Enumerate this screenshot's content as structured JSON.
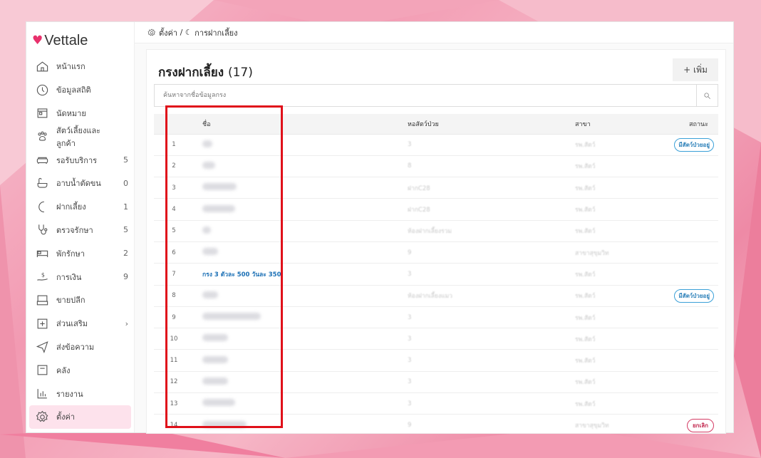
{
  "app": {
    "brand": "Vettale"
  },
  "breadcrumb": {
    "settings": "ตั้งค่า",
    "separator": "/",
    "current": "การฝากเลี้ยง"
  },
  "sidebar": {
    "items": [
      {
        "icon": "home-icon",
        "label": "หน้าแรก",
        "count": ""
      },
      {
        "icon": "chart-icon",
        "label": "ข้อมูลสถิติ",
        "count": ""
      },
      {
        "icon": "calendar-icon",
        "label": "นัดหมาย",
        "count": ""
      },
      {
        "icon": "paw-icon",
        "label": "สัตว์เลี้ยงและลูกค้า",
        "count": ""
      },
      {
        "icon": "sofa-icon",
        "label": "รอรับบริการ",
        "count": "5"
      },
      {
        "icon": "bath-icon",
        "label": "อาบน้ำตัดขน",
        "count": "0"
      },
      {
        "icon": "moon-icon",
        "label": "ฝากเลี้ยง",
        "count": "1"
      },
      {
        "icon": "stethoscope-icon",
        "label": "ตรวจรักษา",
        "count": "5"
      },
      {
        "icon": "bed-icon",
        "label": "พักรักษา",
        "count": "2"
      },
      {
        "icon": "money-icon",
        "label": "การเงิน",
        "count": "9"
      },
      {
        "icon": "register-icon",
        "label": "ขายปลีก",
        "count": ""
      },
      {
        "icon": "plus-box-icon",
        "label": "ส่วนเสริม",
        "count": "›"
      },
      {
        "icon": "send-icon",
        "label": "ส่งข้อความ",
        "count": ""
      },
      {
        "icon": "inbox-icon",
        "label": "คลัง",
        "count": ""
      },
      {
        "icon": "report-icon",
        "label": "รายงาน",
        "count": ""
      },
      {
        "icon": "gear-icon",
        "label": "ตั้งค่า",
        "count": ""
      }
    ]
  },
  "main": {
    "title": "กรงฝากเลี้ยง",
    "count": "(17)",
    "add_label": "+ เพิ่ม",
    "search_placeholder": "ค้นหาจากชื่อข้อมูลกรง",
    "columns": {
      "name": "ชื่อ",
      "vet": "หอสัตว์ป่วย",
      "branch": "สาขา",
      "status": "สถานะ"
    },
    "rows": [
      {
        "num": "1",
        "name": "",
        "vet": "3",
        "branch": "รพ.สัตว์",
        "status": "มีสัตว์ป่วยอยู่"
      },
      {
        "num": "2",
        "name": "",
        "vet": "8",
        "branch": "รพ.สัตว์",
        "status": ""
      },
      {
        "num": "3",
        "name": "",
        "vet": "ฝากC28",
        "branch": "รพ.สัตว์",
        "status": ""
      },
      {
        "num": "4",
        "name": "",
        "vet": "ฝากC28",
        "branch": "รพ.สัตว์",
        "status": ""
      },
      {
        "num": "5",
        "name": "",
        "vet": "ห้องฝากเลี้ยงรวม",
        "branch": "รพ.สัตว์",
        "status": ""
      },
      {
        "num": "6",
        "name": "",
        "vet": "9",
        "branch": "สาขาสุขุมวิท",
        "status": ""
      },
      {
        "num": "7",
        "name": "กรง 3 ตัวละ 500 วันละ 350",
        "vet": "3",
        "branch": "รพ.สัตว์",
        "status": ""
      },
      {
        "num": "8",
        "name": "",
        "vet": "ห้องฝากเลี้ยงแมว",
        "branch": "รพ.สัตว์",
        "status": "มีสัตว์ป่วยอยู่"
      },
      {
        "num": "9",
        "name": "",
        "vet": "3",
        "branch": "รพ.สัตว์",
        "status": ""
      },
      {
        "num": "10",
        "name": "",
        "vet": "3",
        "branch": "รพ.สัตว์",
        "status": ""
      },
      {
        "num": "11",
        "name": "",
        "vet": "3",
        "branch": "รพ.สัตว์",
        "status": ""
      },
      {
        "num": "12",
        "name": "",
        "vet": "3",
        "branch": "รพ.สัตว์",
        "status": ""
      },
      {
        "num": "13",
        "name": "",
        "vet": "3",
        "branch": "รพ.สัตว์",
        "status": ""
      },
      {
        "num": "14",
        "name": "",
        "vet": "9",
        "branch": "สาขาสุขุมวิท",
        "status": "ยกเลิก"
      }
    ]
  },
  "colors": {
    "accent": "#e8316c",
    "highlight": "#e0101a",
    "link": "#1a6fb5"
  }
}
